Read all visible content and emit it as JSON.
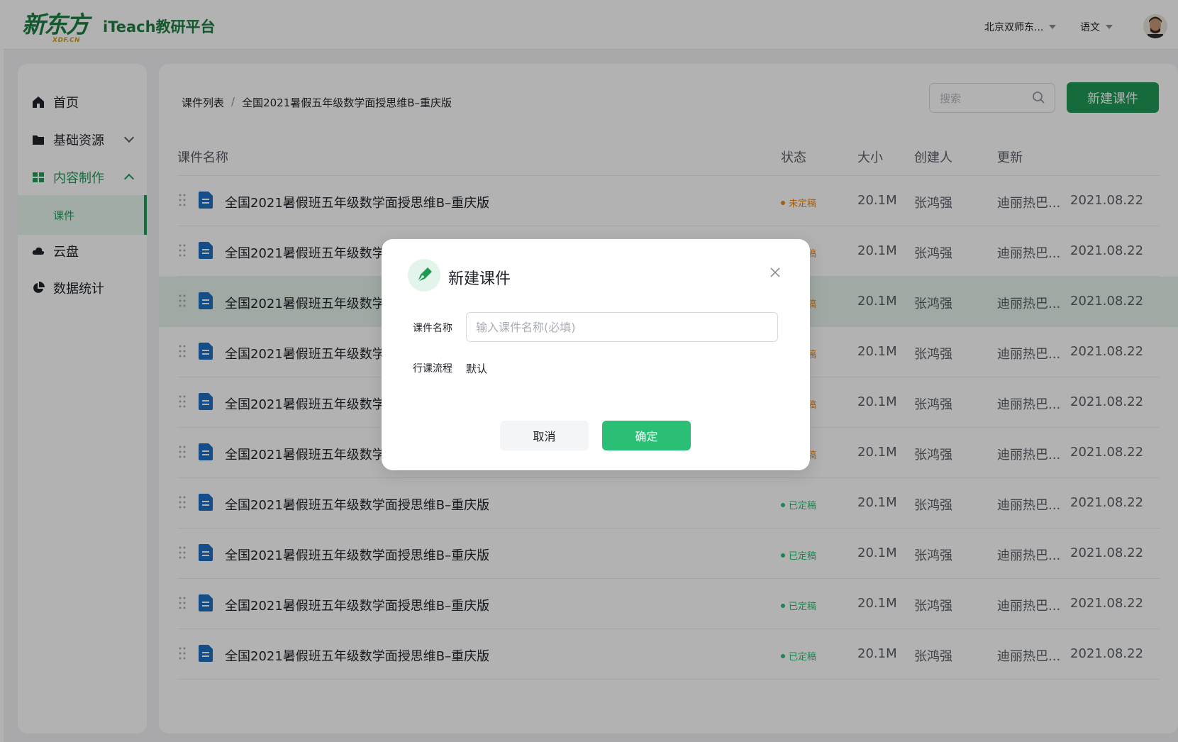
{
  "header": {
    "logo_text": "新东方",
    "logo_subtext": "XDF.CN",
    "app_title": "iTeach教研平台",
    "org_select": "北京双师东...",
    "subject_select": "语文"
  },
  "sidebar": {
    "items": [
      {
        "label": "首页",
        "icon": "home-icon"
      },
      {
        "label": "基础资源",
        "icon": "folder-icon"
      },
      {
        "label": "内容制作",
        "icon": "grid-icon"
      },
      {
        "label": "云盘",
        "icon": "cloud-icon"
      },
      {
        "label": "数据统计",
        "icon": "pie-chart-icon"
      }
    ],
    "sub_item": "课件"
  },
  "content": {
    "breadcrumb": [
      "课件列表",
      "全国2021暑假五年级数学面授思维B–重庆版"
    ],
    "breadcrumb_sep": "/",
    "search_placeholder": "搜索",
    "new_button": "新建课件",
    "columns": [
      "课件名称",
      "状态",
      "大小",
      "创建人",
      "更新"
    ],
    "rows": [
      {
        "name": "全国2021暑假班五年级数学面授思维B–重庆版",
        "status": "未定稿",
        "size": "20.1M",
        "creator": "张鸿强",
        "updater": "迪丽热巴...",
        "date": "2021.08.22"
      },
      {
        "name": "全国2021暑假班五年级数学面授思维B–重庆版",
        "status": "未定稿",
        "size": "20.1M",
        "creator": "张鸿强",
        "updater": "迪丽热巴...",
        "date": "2021.08.22"
      },
      {
        "name": "全国2021暑假班五年级数学面授思维B–重庆版",
        "status": "未定稿",
        "size": "20.1M",
        "creator": "张鸿强",
        "updater": "迪丽热巴...",
        "date": "2021.08.22"
      },
      {
        "name": "全国2021暑假班五年级数学面授思维B–重庆版",
        "status": "未定稿",
        "size": "20.1M",
        "creator": "张鸿强",
        "updater": "迪丽热巴...",
        "date": "2021.08.22"
      },
      {
        "name": "全国2021暑假班五年级数学面授思维B–重庆版",
        "status": "未定稿",
        "size": "20.1M",
        "creator": "张鸿强",
        "updater": "迪丽热巴...",
        "date": "2021.08.22"
      },
      {
        "name": "全国2021暑假班五年级数学面授思维B–重庆版",
        "status": "未定稿",
        "size": "20.1M",
        "creator": "张鸿强",
        "updater": "迪丽热巴...",
        "date": "2021.08.22"
      },
      {
        "name": "全国2021暑假班五年级数学面授思维B–重庆版",
        "status": "已定稿",
        "size": "20.1M",
        "creator": "张鸿强",
        "updater": "迪丽热巴...",
        "date": "2021.08.22"
      },
      {
        "name": "全国2021暑假班五年级数学面授思维B–重庆版",
        "status": "已定稿",
        "size": "20.1M",
        "creator": "张鸿强",
        "updater": "迪丽热巴...",
        "date": "2021.08.22"
      },
      {
        "name": "全国2021暑假班五年级数学面授思维B–重庆版",
        "status": "已定稿",
        "size": "20.1M",
        "creator": "张鸿强",
        "updater": "迪丽热巴...",
        "date": "2021.08.22"
      },
      {
        "name": "全国2021暑假班五年级数学面授思维B–重庆版",
        "status": "已定稿",
        "size": "20.1M",
        "creator": "张鸿强",
        "updater": "迪丽热巴...",
        "date": "2021.08.22"
      }
    ]
  },
  "modal": {
    "title": "新建课件",
    "name_label": "课件名称",
    "name_placeholder": "输入课件名称(必填)",
    "name_value": "",
    "flow_label": "行课流程",
    "flow_value": "默认",
    "cancel": "取消",
    "confirm": "确定"
  },
  "colors": {
    "brand": "#1f9a55",
    "confirm": "#2abf75",
    "status_draft": "#e8891d",
    "status_final": "#2abf75",
    "highlight_row": "#e5f3ea"
  }
}
